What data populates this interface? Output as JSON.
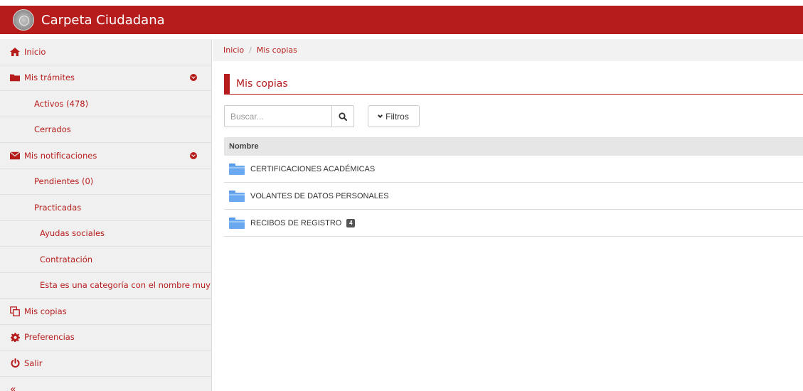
{
  "header": {
    "app_title": "Carpeta Ciudadana",
    "bg_color": "#b71c1c"
  },
  "sidebar": {
    "items": [
      {
        "label": "Inicio",
        "icon": "home-icon"
      },
      {
        "label": "Mis trámites",
        "icon": "folder-icon",
        "expanded": true
      },
      {
        "label": "Activos (478)"
      },
      {
        "label": "Cerrados"
      },
      {
        "label": "Mis notificaciones",
        "icon": "envelope-icon",
        "expanded": true
      },
      {
        "label": "Pendientes (0)"
      },
      {
        "label": "Practicadas",
        "active": true
      },
      {
        "label": "Ayudas sociales"
      },
      {
        "label": "Contratación"
      },
      {
        "label": "Esta es una categoría con el nombre muy l..."
      },
      {
        "label": "Mis copias",
        "icon": "copy-icon"
      },
      {
        "label": "Preferencias",
        "icon": "gear-icon"
      },
      {
        "label": "Salir",
        "icon": "power-icon"
      },
      {
        "label": "«",
        "icon": "collapse-icon"
      }
    ]
  },
  "breadcrumb": {
    "home": "Inicio",
    "separator": "/",
    "current": "Mis copias"
  },
  "main": {
    "title": "Mis copias",
    "search": {
      "placeholder": "Buscar...",
      "value": ""
    },
    "filters_label": "Filtros",
    "table": {
      "column": "Nombre",
      "rows": [
        {
          "name": "CERTIFICACIONES ACADÉMICAS",
          "badge": null
        },
        {
          "name": "VOLANTES DE DATOS PERSONALES",
          "badge": null
        },
        {
          "name": "RECIBOS DE REGISTRO",
          "badge": "4"
        }
      ]
    }
  }
}
